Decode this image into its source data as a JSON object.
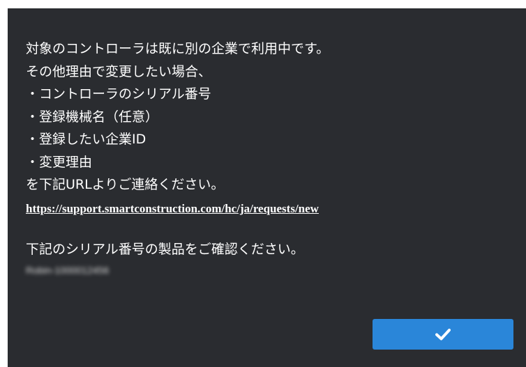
{
  "dialog": {
    "message_lines": [
      "対象のコントローラは既に別の企業で利用中です。",
      "その他理由で変更したい場合、",
      "・コントローラのシリアル番号",
      "・登録機械名（任意）",
      "・登録したい企業ID",
      "・変更理由",
      "を下記URLよりご連絡ください。"
    ],
    "support_url": "https://support.smartconstruction.com/hc/ja/requests/new",
    "confirm_serial_text": "下記のシリアル番号の製品をご確認ください。",
    "serial_number": "Robin-1000012456",
    "ok_icon": "checkmark-icon",
    "colors": {
      "background": "#2a2c30",
      "text": "#ffffff",
      "button": "#2a86d9"
    }
  }
}
